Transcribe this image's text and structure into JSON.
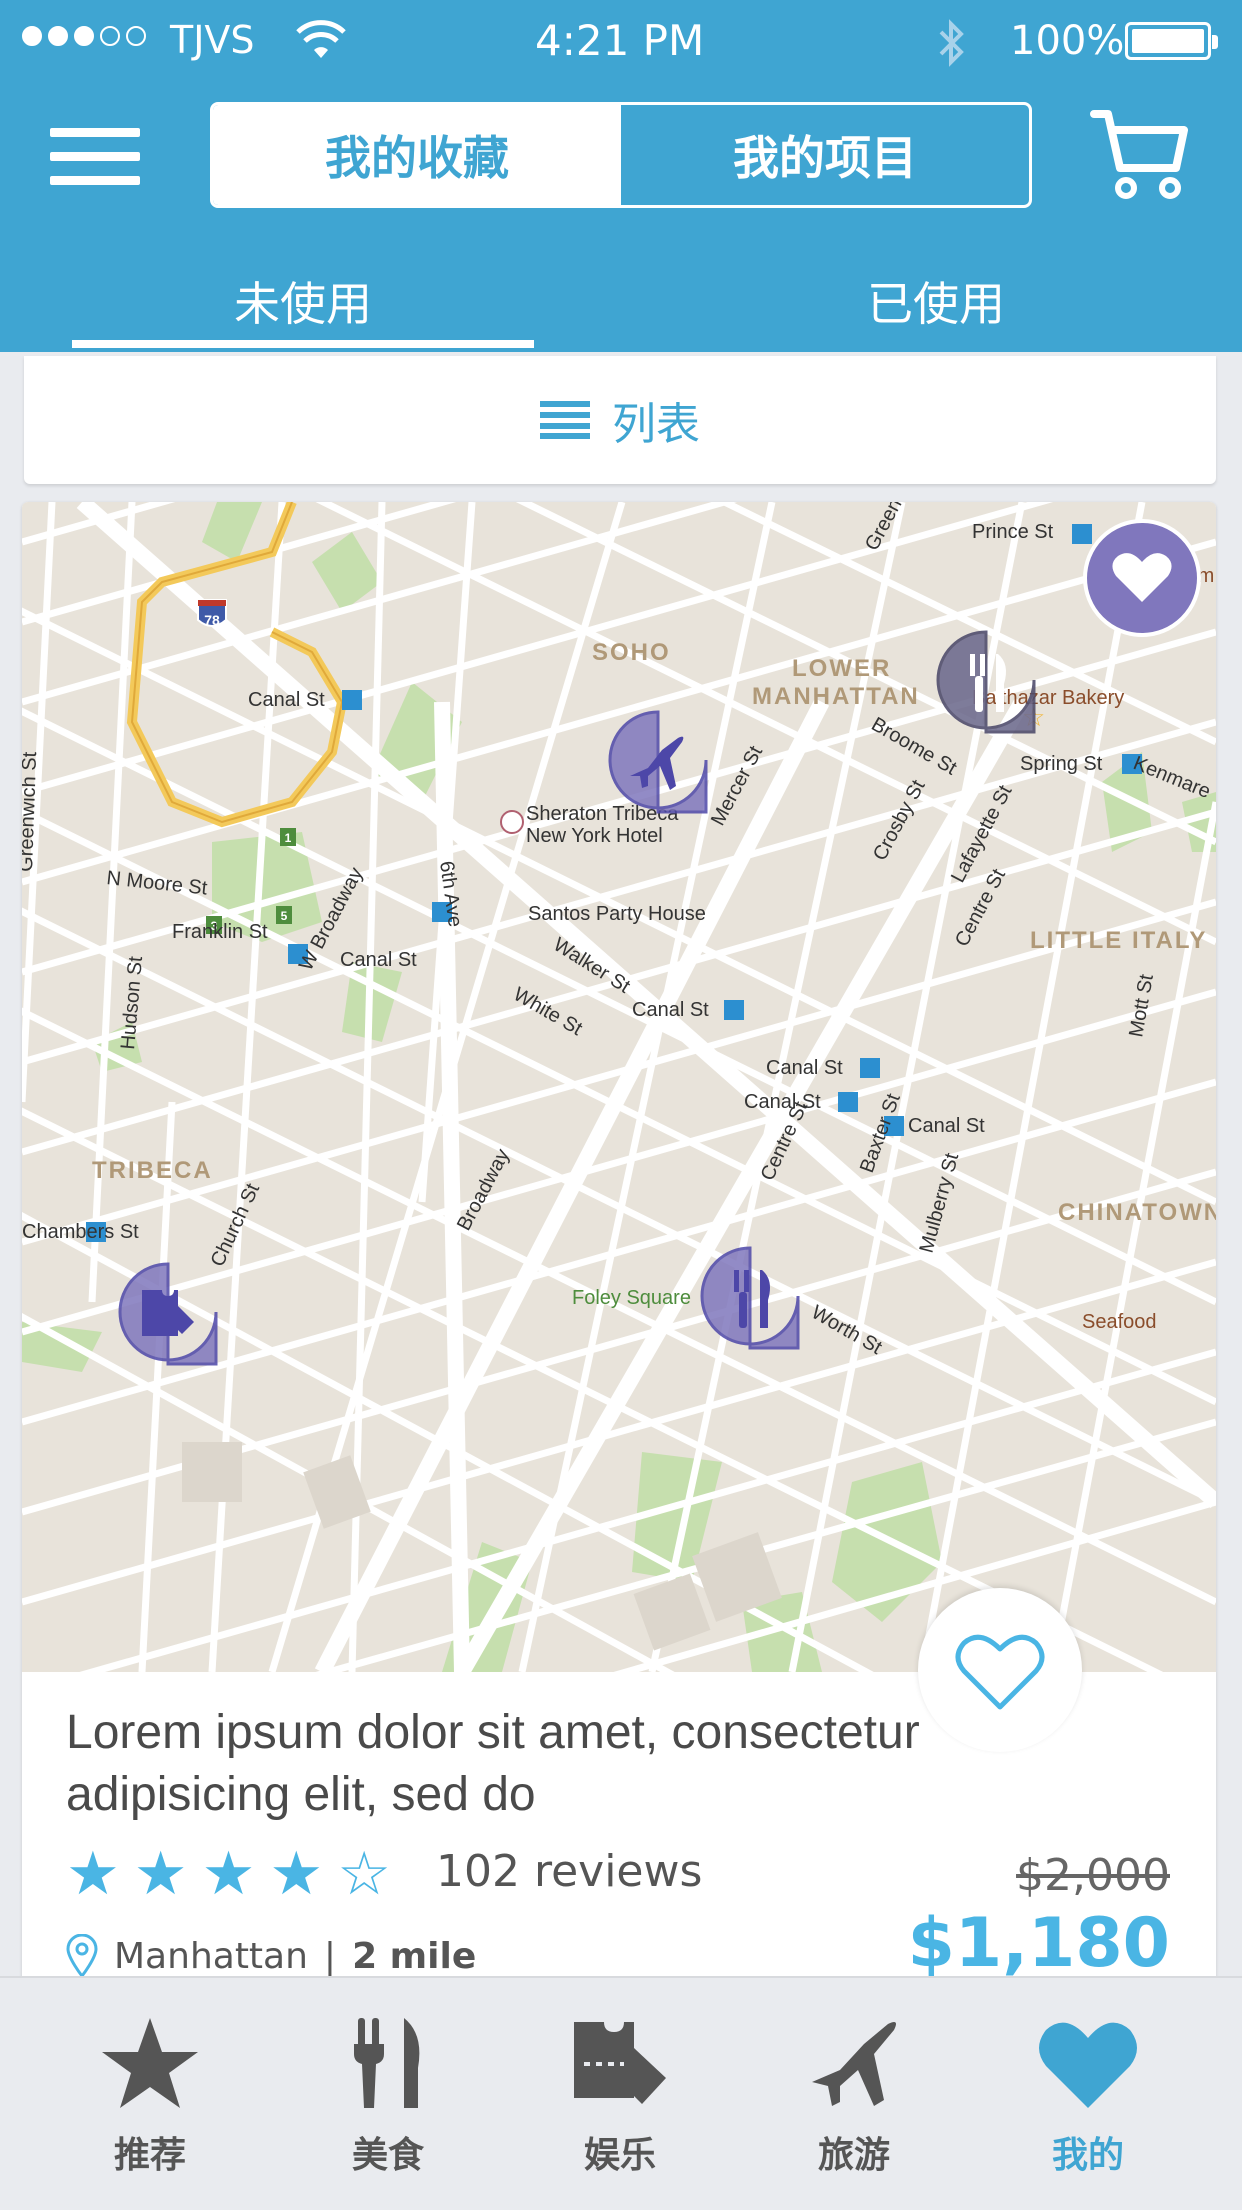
{
  "status_bar": {
    "carrier": "TJVS",
    "time": "4:21 PM",
    "battery": "100%"
  },
  "header": {
    "segment": [
      "我的收藏",
      "我的项目"
    ],
    "subtabs": [
      "未使用",
      "已使用"
    ]
  },
  "list_toggle": {
    "label": "列表"
  },
  "map": {
    "labels": {
      "prince_st": "Prince St",
      "soho": "SOHO",
      "lower_manhattan_1": "LOWER",
      "lower_manhattan_2": "MANHATTAN",
      "canal_1": "Canal St",
      "canal_2": "Canal St",
      "canal_3": "Canal St",
      "canal_4": "Canal St",
      "canal_5": "Canal St",
      "canal_6": "Canal St",
      "spring_st": "Spring St",
      "broome_st": "Broome St",
      "kenmare": "Kenmare",
      "sheraton_1": "Sheraton Tribeca",
      "sheraton_2": "New York Hotel",
      "mercer_st": "Mercer St",
      "crosby_st": "Crosby St",
      "lafayette_st": "Lafayette St",
      "centre_st": "Centre St",
      "centre_st_2": "Centre St",
      "little_italy": "LITTLE ITALY",
      "n_moore": "N Moore St",
      "franklin": "Franklin St",
      "w_broadway": "W Broadway",
      "sixth_ave": "6th Ave",
      "walker": "Walker St",
      "white": "White St",
      "santos": "Santos Party House",
      "hudson": "Hudson St",
      "tribeca": "TRIBECA",
      "church": "Church St",
      "broadway": "Broadway",
      "baxter": "Baxter St",
      "mulberry": "Mulberry St",
      "mott": "Mott St",
      "chinatown": "CHINATOWN",
      "foley": "Foley Square",
      "worth": "Worth St",
      "seafood": "Seafood",
      "bakery": "Balthazar Bakery",
      "greenwich": "Greenwich St",
      "greene": "Greene St",
      "chambers": "Chambers St",
      "ham": "Ham",
      "hw78": "78",
      "exit1": "1",
      "exit3": "3",
      "exit5": "5"
    }
  },
  "listing": {
    "title": "Lorem ipsum dolor sit amet, consectetur adipisicing elit, sed do",
    "rating": 4,
    "rating_max": 5,
    "stars": [
      "★",
      "★",
      "★",
      "★",
      "☆"
    ],
    "reviews": "102 reviews",
    "original_price": "$2,000",
    "price": "$1,180",
    "location": "Manhattan",
    "separator": "|",
    "distance": "2 mile"
  },
  "tabbar": [
    {
      "label": "推荐",
      "icon": "star-icon"
    },
    {
      "label": "美食",
      "icon": "fork-knife-icon"
    },
    {
      "label": "娱乐",
      "icon": "ticket-icon"
    },
    {
      "label": "旅游",
      "icon": "airplane-icon"
    },
    {
      "label": "我的",
      "icon": "heart-icon"
    }
  ],
  "colors": {
    "primary": "#3fa5d2",
    "accent": "#4ab5e4",
    "pin": "#8077bd",
    "pin_stroke": "#4d47a8"
  }
}
